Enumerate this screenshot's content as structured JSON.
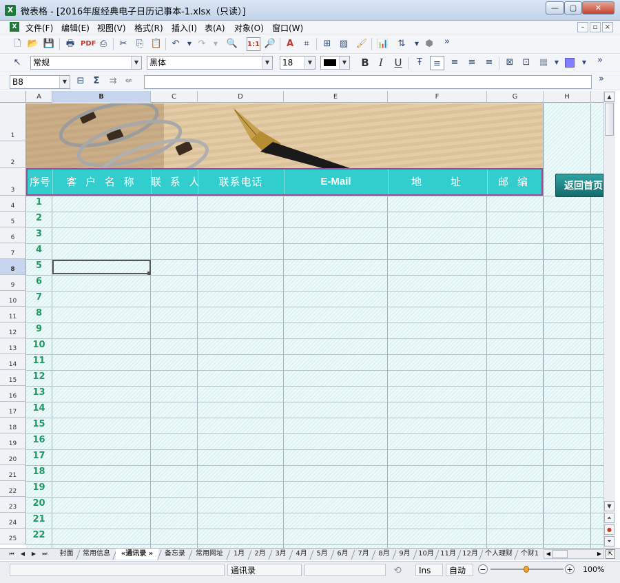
{
  "window": {
    "title": "微表格 - [2016年度经典电子日历记事本-1.xlsx（只读）]",
    "app_icon": "X",
    "minimize": "—",
    "maximize": "▢",
    "close": "✕"
  },
  "menu": {
    "items": [
      "文件(F)",
      "编辑(E)",
      "视图(V)",
      "格式(R)",
      "插入(I)",
      "表(A)",
      "对象(O)",
      "窗口(W)"
    ],
    "doc_minimize": "–",
    "doc_restore": "▫",
    "doc_close": "×"
  },
  "toolbar1": {
    "icons": [
      "new-icon",
      "open-icon",
      "save-icon",
      "print-icon",
      "pdf-icon",
      "preview-icon",
      "cut-icon",
      "copy-icon",
      "paste-icon",
      "undo-icon",
      "redo-icon",
      "find-icon",
      "actual-size-icon",
      "zoom-icon",
      "text-color-a-icon",
      "crop-icon",
      "table-icon",
      "hatch-icon",
      "brush-icon",
      "chart-icon",
      "sort-icon",
      "stack-icon"
    ],
    "actual_size_label": "1:1",
    "more": "»"
  },
  "toolbar2": {
    "number_format": "常规",
    "font_name": "黑体",
    "font_size": "18",
    "bold": "B",
    "italic": "I",
    "underline": "U",
    "more": "»"
  },
  "formula_bar": {
    "cell_ref": "B8",
    "formula": "",
    "more": "»"
  },
  "columns": [
    "A",
    "B",
    "C",
    "D",
    "E",
    "F",
    "G",
    "H"
  ],
  "selected_column": "B",
  "rows": [
    "1",
    "2",
    "3",
    "4",
    "5",
    "6",
    "7",
    "8",
    "9",
    "10",
    "11",
    "12",
    "13",
    "14",
    "15",
    "16",
    "17",
    "18",
    "19",
    "20",
    "21",
    "22",
    "23",
    "24",
    "25"
  ],
  "selected_row": "8",
  "table": {
    "headers": [
      "序号",
      "客 户 名 称",
      "联 系 人",
      "联系电话",
      "E-Mail",
      "地　　址",
      "邮 编"
    ],
    "sequence": [
      "1",
      "2",
      "3",
      "4",
      "5",
      "6",
      "7",
      "8",
      "9",
      "10",
      "11",
      "12",
      "13",
      "14",
      "15",
      "16",
      "17",
      "18",
      "19",
      "20",
      "21",
      "22"
    ]
  },
  "home_button": "返回首页",
  "sheet_tabs": [
    "封面",
    "常用信息",
    "«通讯录 »",
    "备忘录",
    "常用网址",
    "1月",
    "2月",
    "3月",
    "4月",
    "5月",
    "6月",
    "7月",
    "8月",
    "9月",
    "10月",
    "11月",
    "12月",
    "个人理财",
    "个财1"
  ],
  "active_tab": "«通讯录 »",
  "status": {
    "sheet_name": "通讯录",
    "mode": "Ins",
    "calc": "自动",
    "zoom": "100%",
    "zoom_level": 0.5
  },
  "colors": {
    "header_band": "#32cdcd",
    "header_border": "#9a4e9a",
    "sequence_text": "#1f9b62",
    "home_button": "#1f8585"
  }
}
